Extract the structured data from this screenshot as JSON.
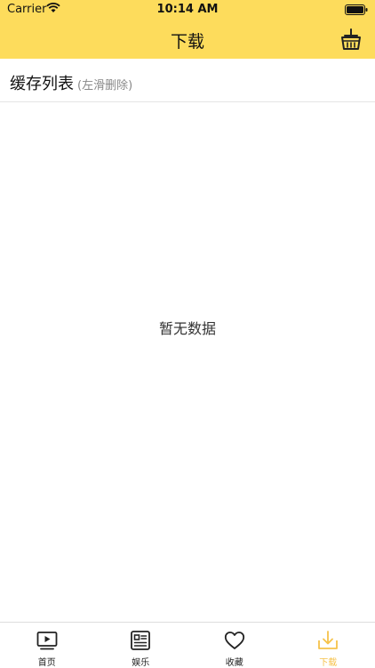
{
  "status_bar": {
    "carrier": "Carrier",
    "time": "10:14 AM"
  },
  "navbar": {
    "title": "下载",
    "right_icon": "basket-icon"
  },
  "section": {
    "title": "缓存列表",
    "hint": "(左滑删除)"
  },
  "empty_state": {
    "text": "暂无数据"
  },
  "tabbar": {
    "items": [
      {
        "label": "首页",
        "icon": "tv-play-icon",
        "active": false
      },
      {
        "label": "娱乐",
        "icon": "news-icon",
        "active": false
      },
      {
        "label": "收藏",
        "icon": "heart-icon",
        "active": false
      },
      {
        "label": "下载",
        "icon": "download-icon",
        "active": true
      }
    ]
  },
  "colors": {
    "header_bg": "#fddc5c",
    "active_tab": "#f6c24a"
  }
}
